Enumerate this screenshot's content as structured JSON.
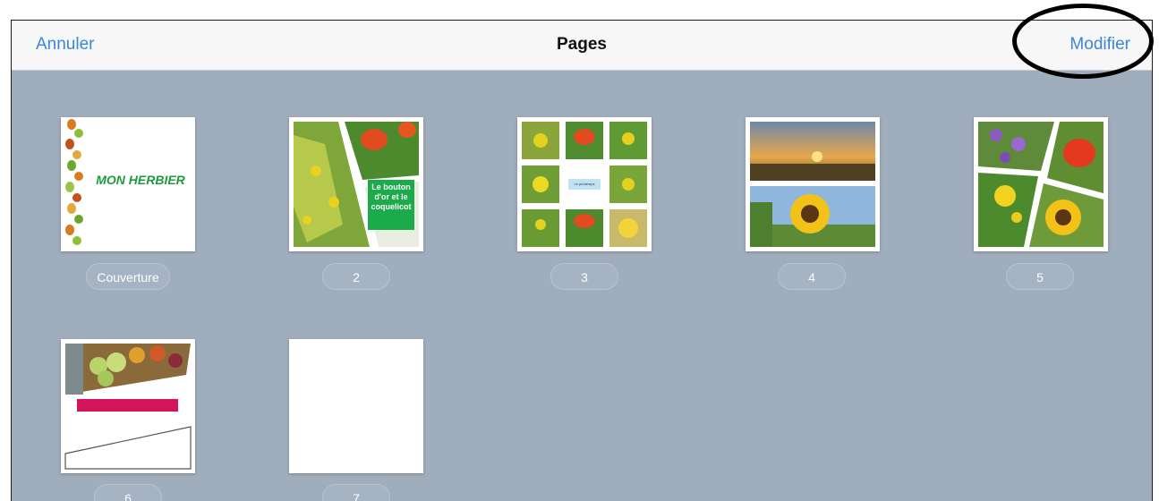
{
  "navbar": {
    "cancel_label": "Annuler",
    "title": "Pages",
    "edit_label": "Modifier"
  },
  "pages": [
    {
      "label": "Couverture",
      "cover_title": "MON HERBIER"
    },
    {
      "label": "2",
      "caption": "Le bouton d'or et le coquelicot"
    },
    {
      "label": "3",
      "caption": "Le printemps"
    },
    {
      "label": "4"
    },
    {
      "label": "5"
    },
    {
      "label": "6"
    },
    {
      "label": "7"
    }
  ],
  "colors": {
    "accent": "#3a86d8",
    "grid_background": "#a0adbd",
    "caption_green": "#1cab4a",
    "caption_pink": "#d4145a"
  }
}
